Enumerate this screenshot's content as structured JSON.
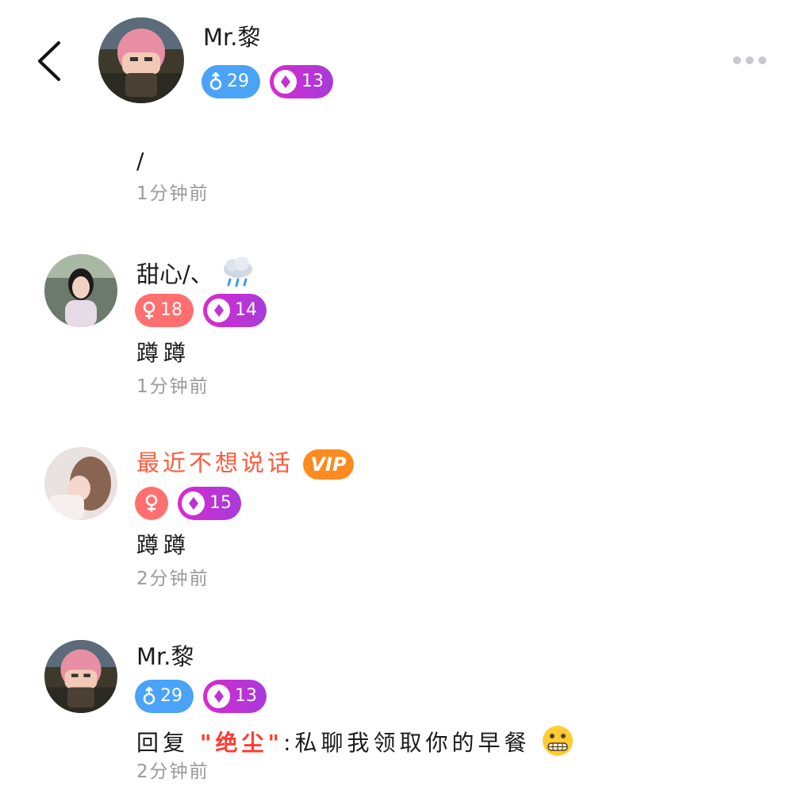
{
  "header": {
    "user_name": "Mr.黎",
    "gender_age": "29",
    "level": "13"
  },
  "top_comment": {
    "content": "/",
    "time": "1分钟前"
  },
  "comments": [
    {
      "name": "甜心/、",
      "name_emoji": "rain-cloud-emoji",
      "gender": "female",
      "age": "18",
      "level": "14",
      "content": "蹲蹲",
      "time": "1分钟前"
    },
    {
      "name": "最近不想说话",
      "vip": "VIP",
      "gender": "female",
      "age": "",
      "level": "15",
      "content": "蹲蹲",
      "time": "2分钟前"
    },
    {
      "name": "Mr.黎",
      "gender": "male",
      "age": "29",
      "level": "13",
      "reply_prefix": "回复",
      "reply_target": "\"绝尘\"",
      "reply_text": ":私聊我领取你的早餐",
      "reply_emoji": "grimacing-face-emoji",
      "time": "2分钟前"
    }
  ],
  "colors": {
    "male_badge": "#4aa3f7",
    "female_badge": "#ff6f6f",
    "level_badge": "#c032d5",
    "vip_badge": "#ff8a1f",
    "vip_name": "#ff5a3c",
    "time_text": "#9a9a9a"
  }
}
